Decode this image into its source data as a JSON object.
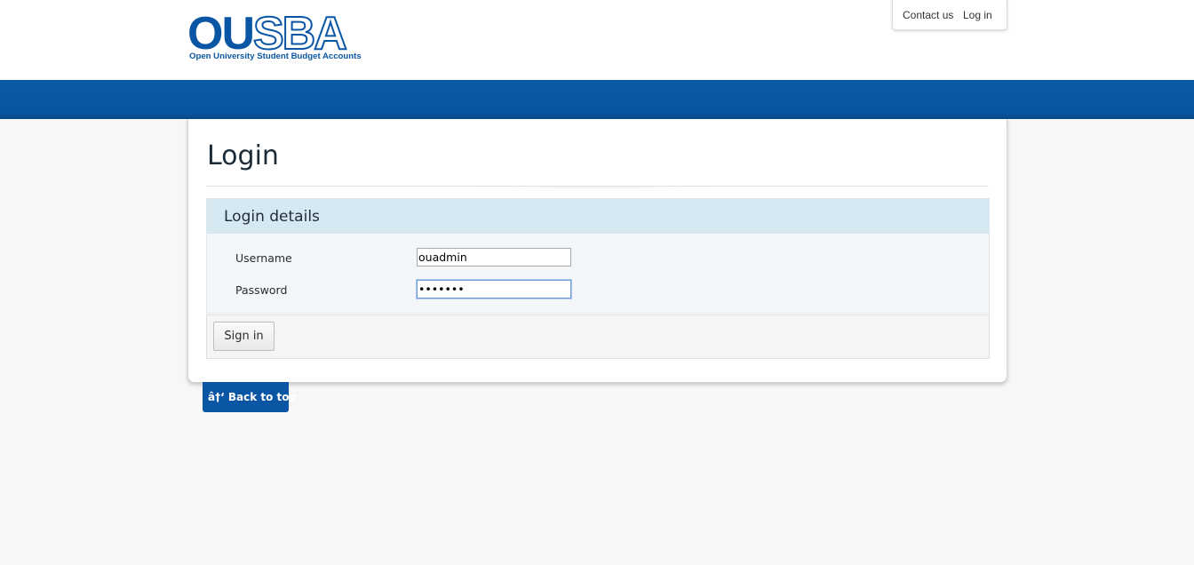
{
  "header": {
    "logo": {
      "text_main_part1": "OU",
      "text_main_part2": "SBA",
      "subtitle": "Open University Student Budget Accounts"
    },
    "nav": {
      "contact_label": "Contact us",
      "login_label": "Log in"
    }
  },
  "main": {
    "title": "Login",
    "fieldset_legend": "Login details",
    "username_label": "Username",
    "username_value": "ouadmin",
    "password_label": "Password",
    "password_value": "•••••••",
    "signin_label": "Sign in"
  },
  "footer": {
    "back_to_top_label": "â†‘ Back to top"
  },
  "colors": {
    "brand_blue": "#0a56a5",
    "legend_bg": "#d6e8f1",
    "fieldset_bg": "#f3f7fa",
    "page_bg": "#f7f7f7"
  }
}
